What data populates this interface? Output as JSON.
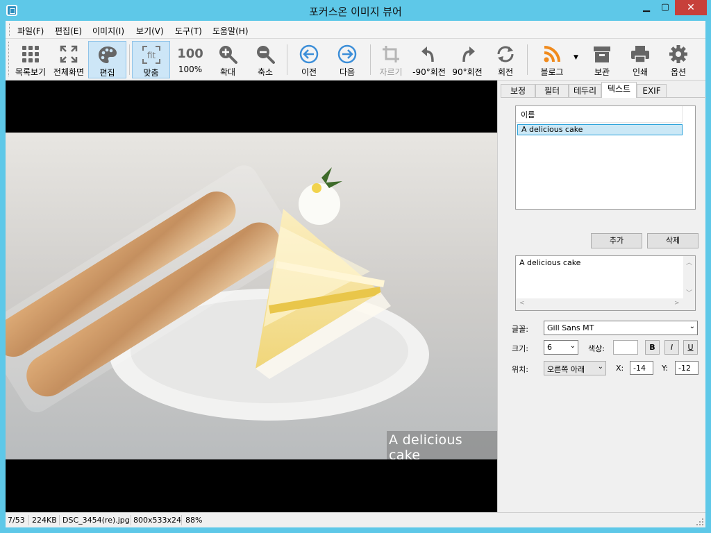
{
  "window": {
    "title": "포커스온 이미지 뷰어"
  },
  "menu": [
    "파일(F)",
    "편집(E)",
    "이미지(I)",
    "보기(V)",
    "도구(T)",
    "도움말(H)"
  ],
  "toolbar": {
    "list_view": "목록보기",
    "fullscreen": "전체화면",
    "edit": "편집",
    "fit": "맞춤",
    "fit_icon_text": "fit",
    "actual_size": "100%",
    "actual_size_icon_text": "100",
    "zoom_in": "확대",
    "zoom_out": "축소",
    "prev": "이전",
    "next": "다음",
    "crop": "자르기",
    "rotate_ccw": "-90°회전",
    "rotate_cw": "90°회전",
    "rotate": "회전",
    "blog": "블로그",
    "archive": "보관",
    "print": "인쇄",
    "options": "옵션"
  },
  "image": {
    "caption": "A delicious cake"
  },
  "panel": {
    "tabs": [
      "보정",
      "필터",
      "테두리",
      "텍스트",
      "EXIF"
    ],
    "active_tab": "텍스트",
    "list_header": "이름",
    "list_items": [
      "A delicious cake"
    ],
    "add_button": "추가",
    "delete_button": "삭제",
    "text_value": "A delicious cake",
    "font_label": "글꼴:",
    "font_value": "Gill Sans MT",
    "size_label": "크기:",
    "size_value": "6",
    "color_label": "색상:",
    "color_value": "#ffffff",
    "bold": "B",
    "italic": "I",
    "underline": "U",
    "position_label": "위치:",
    "position_value": "오른쪽 아래",
    "x_label": "X:",
    "x_value": "-14",
    "y_label": "Y:",
    "y_value": "-12"
  },
  "status": {
    "index": "7/53",
    "filesize": "224KB",
    "filename": "DSC_3454(re).jpg",
    "dimensions": "800x533x24",
    "zoom": "88%"
  }
}
